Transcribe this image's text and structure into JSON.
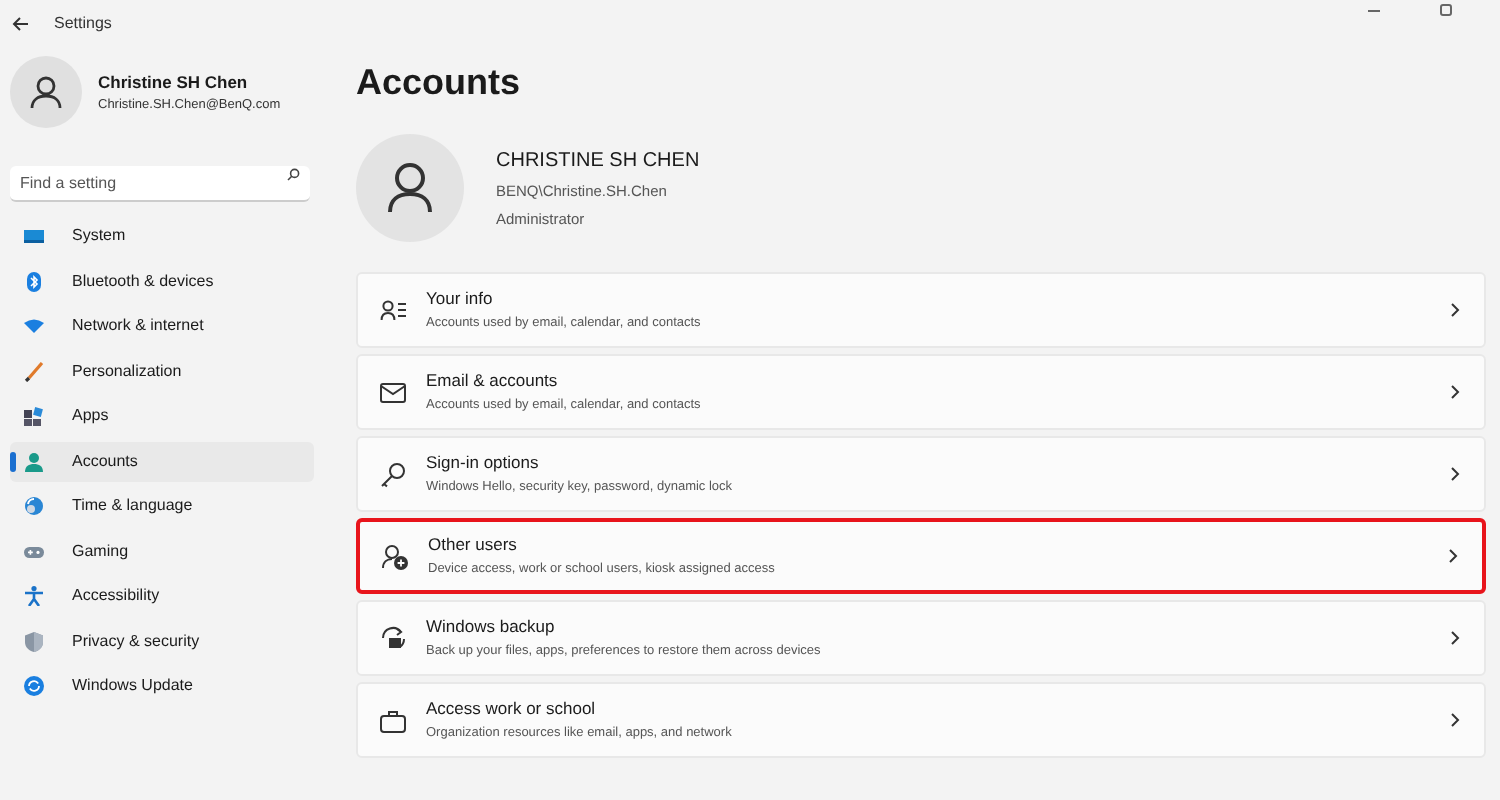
{
  "window": {
    "title": "Settings"
  },
  "profile": {
    "name": "Christine SH Chen",
    "email": "Christine.SH.Chen@BenQ.com"
  },
  "search": {
    "placeholder": "Find a setting"
  },
  "sidebar": {
    "items": [
      {
        "label": "System",
        "selected": false
      },
      {
        "label": "Bluetooth & devices",
        "selected": false
      },
      {
        "label": "Network & internet",
        "selected": false
      },
      {
        "label": "Personalization",
        "selected": false
      },
      {
        "label": "Apps",
        "selected": false
      },
      {
        "label": "Accounts",
        "selected": true
      },
      {
        "label": "Time & language",
        "selected": false
      },
      {
        "label": "Gaming",
        "selected": false
      },
      {
        "label": "Accessibility",
        "selected": false
      },
      {
        "label": "Privacy & security",
        "selected": false
      },
      {
        "label": "Windows Update",
        "selected": false
      }
    ]
  },
  "page": {
    "title": "Accounts",
    "user": {
      "name": "CHRISTINE SH CHEN",
      "account": "BENQ\\Christine.SH.Chen",
      "role": "Administrator"
    }
  },
  "cards": [
    {
      "title": "Your info",
      "description": "Accounts used by email, calendar, and contacts",
      "highlighted": false
    },
    {
      "title": "Email & accounts",
      "description": "Accounts used by email, calendar, and contacts",
      "highlighted": false
    },
    {
      "title": "Sign-in options",
      "description": "Windows Hello, security key, password, dynamic lock",
      "highlighted": false
    },
    {
      "title": "Other users",
      "description": "Device access, work or school users, kiosk assigned access",
      "highlighted": true
    },
    {
      "title": "Windows backup",
      "description": "Back up your files, apps, preferences to restore them across devices",
      "highlighted": false
    },
    {
      "title": "Access work or school",
      "description": "Organization resources like email, apps, and network",
      "highlighted": false
    }
  ]
}
